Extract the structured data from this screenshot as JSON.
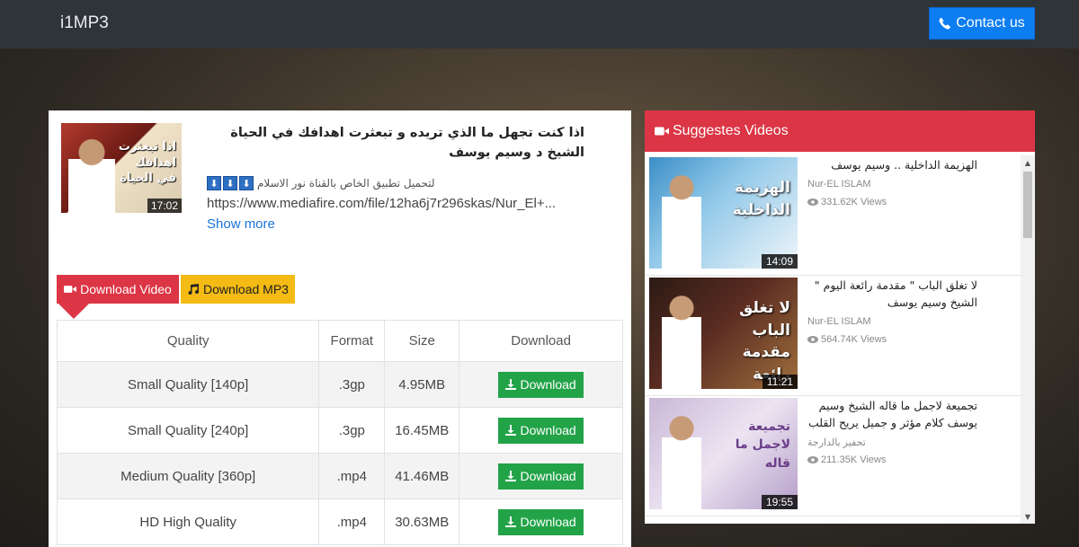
{
  "navbar": {
    "brand": "i1MP3",
    "contact_label": "Contact us"
  },
  "video": {
    "thumb_title": "اذا تبعثرت اهدافك في الحياة",
    "duration": "17:02",
    "title": "اذا كنت تجهل ما الذي تريده و تبعثرت اهدافك في الحياة الشيخ د وسيم يوسف",
    "desc_arrows": [
      "⬇",
      "⬇",
      "⬇"
    ],
    "desc_text": "لتحميل تطبيق الخاص بالقناة نور الاسلام",
    "desc_url": "https://www.mediafire.com/file/12ha6j7r296skas/Nur_El+...",
    "show_more": "Show more"
  },
  "tabs": {
    "video_label": "Download Video",
    "mp3_label": "Download MP3"
  },
  "table": {
    "headers": {
      "quality": "Quality",
      "format": "Format",
      "size": "Size",
      "download": "Download"
    },
    "rows": [
      {
        "quality": "Small Quality [140p]",
        "format": ".3gp",
        "size": "4.95MB",
        "button": "Download"
      },
      {
        "quality": "Small Quality [240p]",
        "format": ".3gp",
        "size": "16.45MB",
        "button": "Download"
      },
      {
        "quality": "Medium Quality [360p]",
        "format": ".mp4",
        "size": "41.46MB",
        "button": "Download"
      },
      {
        "quality": "HD High Quality",
        "format": ".mp4",
        "size": "30.63MB",
        "button": "Download"
      }
    ]
  },
  "suggested": {
    "header": "Suggestes Videos",
    "items": [
      {
        "thumb_text": "الهزيمة الداخلية",
        "duration": "14:09",
        "title": "الهزيمة الداخلية .. وسيم يوسف",
        "channel": "Nur-EL ISLAM",
        "views": "331.62K Views"
      },
      {
        "thumb_text": "لا تغلق الباب مقدمة رائعة",
        "duration": "11:21",
        "title": "لا تغلق الباب \" مقدمة رائعة اليوم \" الشيخ وسيم يوسف",
        "channel": "Nur-EL ISLAM",
        "views": "564.74K Views"
      },
      {
        "thumb_text": "تجميعة لاجمل ما قاله",
        "duration": "19:55",
        "title": "تجميعة لاجمل ما قاله الشيخ وسيم يوسف كلام مؤثر و جميل يريح القلب",
        "channel": "تحفيز بالدارجة",
        "views": "211.35K Views"
      }
    ]
  },
  "colors": {
    "navbar": "#2f3439",
    "contact_button": "#0d7df2",
    "red_accent": "#dc3545",
    "mp3_tab": "#f3bb14",
    "download_button": "#22a348",
    "link": "#1a73d9"
  },
  "icons": {
    "contact": "phone-icon",
    "video_tab": "video-camera-icon",
    "mp3_tab": "music-note-icon",
    "download": "download-icon",
    "suggested_header": "video-camera-icon",
    "views": "eye-icon"
  }
}
